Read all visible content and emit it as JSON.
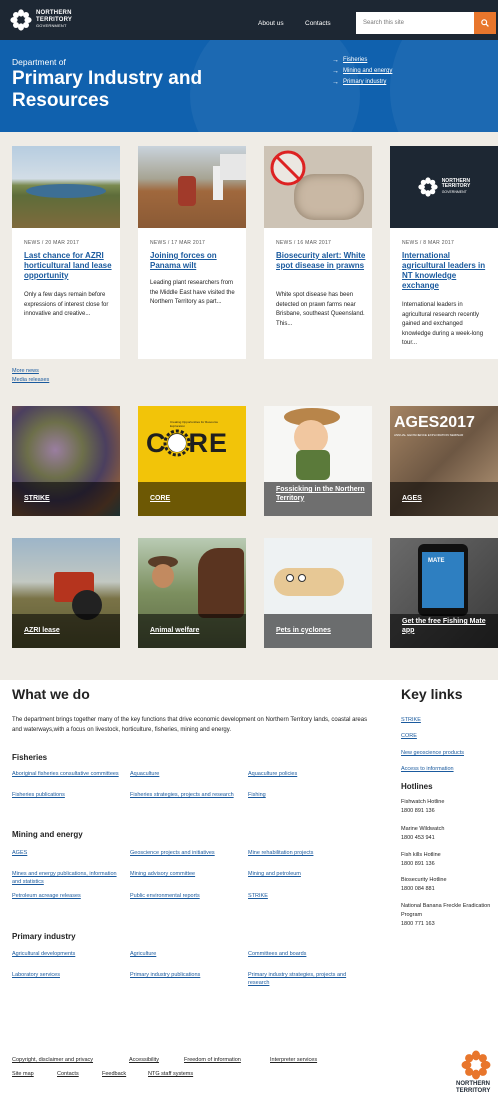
{
  "header": {
    "logo_line1": "NORTHERN",
    "logo_line2": "TERRITORY",
    "logo_line3": "GOVERNMENT",
    "nav": [
      "About us",
      "Contacts"
    ],
    "search_placeholder": "Search this site"
  },
  "hero": {
    "dept": "Department of",
    "title": "Primary Industry and Resources",
    "links": [
      "Fisheries",
      "Mining and energy",
      "Primary industry"
    ]
  },
  "news": [
    {
      "date": "NEWS / 20 MAR 2017",
      "headline": "Last chance for AZRI horticultural land lease opportunity",
      "summary": "Only a few days remain before expressions of interest close for innovative and creative..."
    },
    {
      "date": "NEWS / 17 MAR 2017",
      "headline": "Joining forces on Panama wilt",
      "summary": "Leading plant researchers from the Middle East have visited the Northern Territory as part..."
    },
    {
      "date": "NEWS / 16 MAR 2017",
      "headline": "Biosecurity alert: White spot disease in prawns",
      "summary": "White spot disease has been detected on prawn farms near Brisbane, southeast Queensland. This..."
    },
    {
      "date": "NEWS / 8 MAR 2017",
      "headline": "International agricultural leaders in NT knowledge exchange",
      "summary": "International leaders in agricultural research recently gained and exchanged knowledge during a week-long tour..."
    }
  ],
  "more_news": "More news",
  "media_releases": "Media releases",
  "tiles": [
    {
      "label": "STRIKE"
    },
    {
      "label": "CORE",
      "img_text": "CORE",
      "img_sub": "Creating Opportunities for Resource Exploration"
    },
    {
      "label": "Fossicking in the Northern Territory"
    },
    {
      "label": "AGES",
      "img_text": "AGES2017",
      "img_sub": "ANNUAL GEOSCIENCE EXPLORATION SEMINAR"
    },
    {
      "label": "AZRI lease"
    },
    {
      "label": "Animal welfare"
    },
    {
      "label": "Pets in cyclones"
    },
    {
      "label": "Get the free Fishing Mate app",
      "img_text": "MATE"
    }
  ],
  "what_we_do": {
    "title": "What we do",
    "intro": "The department brings together many of the key functions that drive economic development on Northern Territory lands, coastal areas and waterways,with a focus on livestock, horticulture, fisheries, mining and energy.",
    "sections": [
      {
        "heading": "Fisheries",
        "links": [
          "Aboriginal fisheries consultative committees",
          "Aquaculture",
          "Aquaculture policies",
          "Fisheries publications",
          "Fisheries strategies, projects and research",
          "Fishing"
        ]
      },
      {
        "heading": "Mining and energy",
        "links": [
          "AGES",
          "Geoscience projects and initiatives",
          "Mine rehabilitation projects",
          "Mines and energy publications, information and statistics",
          "Mining advisory committee",
          "Mining and petroleum",
          "Petroleum acreage releases",
          "Public environmental reports",
          "STRIKE"
        ]
      },
      {
        "heading": "Primary industry",
        "links": [
          "Agricultural developments",
          "Agriculture",
          "Committees and boards",
          "Laboratory services",
          "Primary industry publications",
          "Primary industry strategies, projects and research"
        ]
      }
    ]
  },
  "key_links": {
    "title": "Key links",
    "links": [
      "STRIKE",
      "CORE",
      "New geoscience products",
      "Access to information"
    ],
    "hotlines_title": "Hotlines",
    "hotlines": [
      {
        "name": "Fishwatch Hotline",
        "number": "1800 891 136"
      },
      {
        "name": "Marine Wildwatch",
        "number": "1800 453 941"
      },
      {
        "name": "Fish kills Hotline",
        "number": "1800 891 136"
      },
      {
        "name": "Biosecurity Hotline",
        "number": "1800 084 881"
      },
      {
        "name": "National Banana Freckle Eradication Program",
        "number": "1800 771 163"
      }
    ]
  },
  "footer": {
    "links": [
      "Copyright, disclaimer and privacy",
      "Accessibility",
      "Freedom of information",
      "Interpreter services",
      "Site map",
      "Contacts",
      "Feedback",
      "NTG staff systems"
    ],
    "logo_line1": "NORTHERN",
    "logo_line2": "TERRITORY"
  },
  "colors": {
    "hero_blue": "#1061ae",
    "topbar": "#1d2733",
    "search_orange": "#e8762c",
    "link_blue": "#1a5a9e"
  }
}
